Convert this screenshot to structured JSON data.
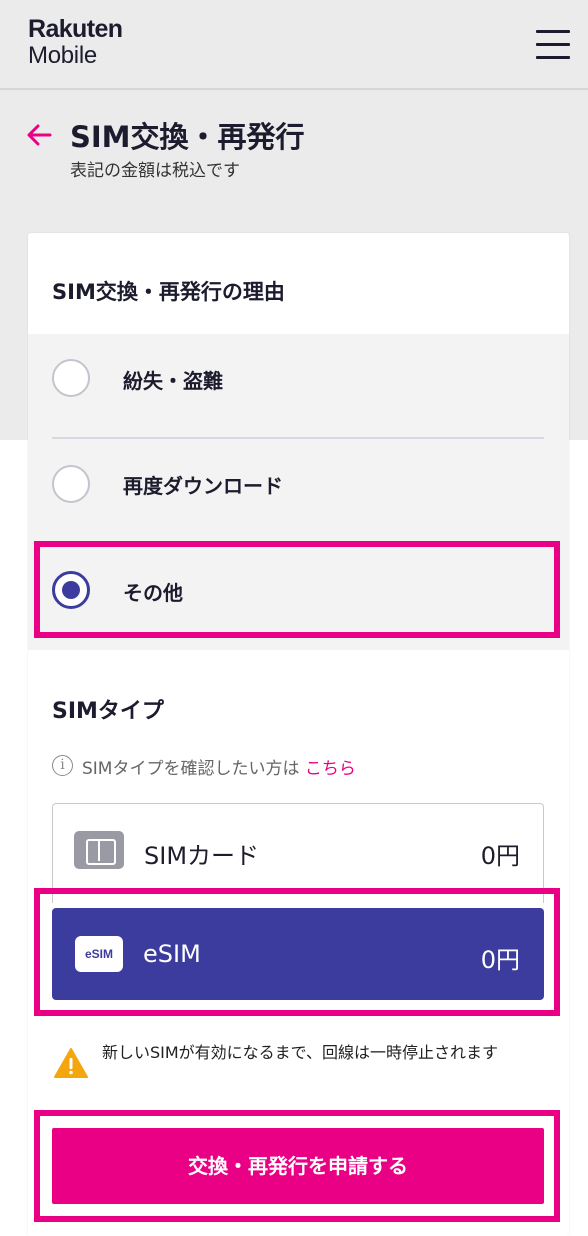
{
  "header": {
    "logo_line1": "Rakuten",
    "logo_line2": "Mobile",
    "menu_icon": "hamburger-menu-icon"
  },
  "page": {
    "back_icon": "arrow-left-icon",
    "title": "SIM交換・再発行",
    "subtitle": "表記の金額は税込です"
  },
  "reason": {
    "title": "SIM交換・再発行の理由",
    "options": [
      {
        "label": "紛失・盗難",
        "selected": false
      },
      {
        "label": "再度ダウンロード",
        "selected": false
      },
      {
        "label": "その他",
        "selected": true
      }
    ]
  },
  "sim_type": {
    "title": "SIMタイプ",
    "info_icon": "info-circle-icon",
    "info_text": "SIMタイプを確認したい方は",
    "info_link": "こちら",
    "options": [
      {
        "label": "SIMカード",
        "price": "0円",
        "icon": "sim-card-icon",
        "selected": false
      },
      {
        "label": "eSIM",
        "price": "0円",
        "icon": "esim-icon",
        "icon_text": "eSIM",
        "selected": true
      }
    ]
  },
  "warning": {
    "icon": "warning-triangle-icon",
    "text": "新しいSIMが有効になるまで、回線は一時停止されます"
  },
  "submit": {
    "label": "交換・再発行を申請する"
  },
  "colors": {
    "accent": "#ea0084",
    "primary": "#3c3c9e",
    "text": "#1c1c2e",
    "background": "#ebebeb",
    "warning": "#f4a60f"
  }
}
